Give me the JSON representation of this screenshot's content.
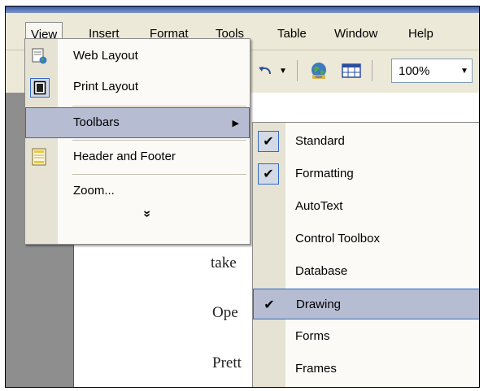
{
  "menubar": {
    "items": [
      {
        "label": "View",
        "active": true
      },
      {
        "label": "Insert"
      },
      {
        "label": "Format"
      },
      {
        "label": "Tools"
      },
      {
        "label": "Table"
      },
      {
        "label": "Window"
      },
      {
        "label": "Help"
      }
    ]
  },
  "toolbar": {
    "undo_icon": "undo-icon",
    "globe_icon": "web-globe-icon",
    "table_icon": "table-icon",
    "zoom_value": "100%"
  },
  "view_menu": {
    "items": [
      {
        "label": "Web Layout",
        "icon": "web-layout-icon"
      },
      {
        "label": "Print Layout",
        "icon": "print-layout-icon"
      },
      {
        "label": "Toolbars",
        "highlighted": true,
        "has_submenu": true
      },
      {
        "label": "Header and Footer",
        "icon": "header-footer-icon"
      },
      {
        "label": "Zoom...",
        "icon": ""
      }
    ],
    "expand_glyph": "»"
  },
  "toolbars_submenu": {
    "items": [
      {
        "label": "Standard",
        "checked": true
      },
      {
        "label": "Formatting",
        "checked": true
      },
      {
        "label": "AutoText",
        "checked": false
      },
      {
        "label": "Control Toolbox",
        "checked": false
      },
      {
        "label": "Database",
        "checked": false
      },
      {
        "label": "Drawing",
        "checked": true,
        "highlighted": true
      },
      {
        "label": "Forms",
        "checked": false
      },
      {
        "label": "Frames",
        "checked": false
      }
    ],
    "check_glyph": "✔"
  },
  "document": {
    "lines": [
      "take",
      "Ope",
      "Prett"
    ]
  },
  "colors": {
    "menu_bg": "#ece9d8",
    "highlight": "#b6bdd2",
    "highlight_border": "#316ac5",
    "doc_gray": "#8e8e8e"
  }
}
